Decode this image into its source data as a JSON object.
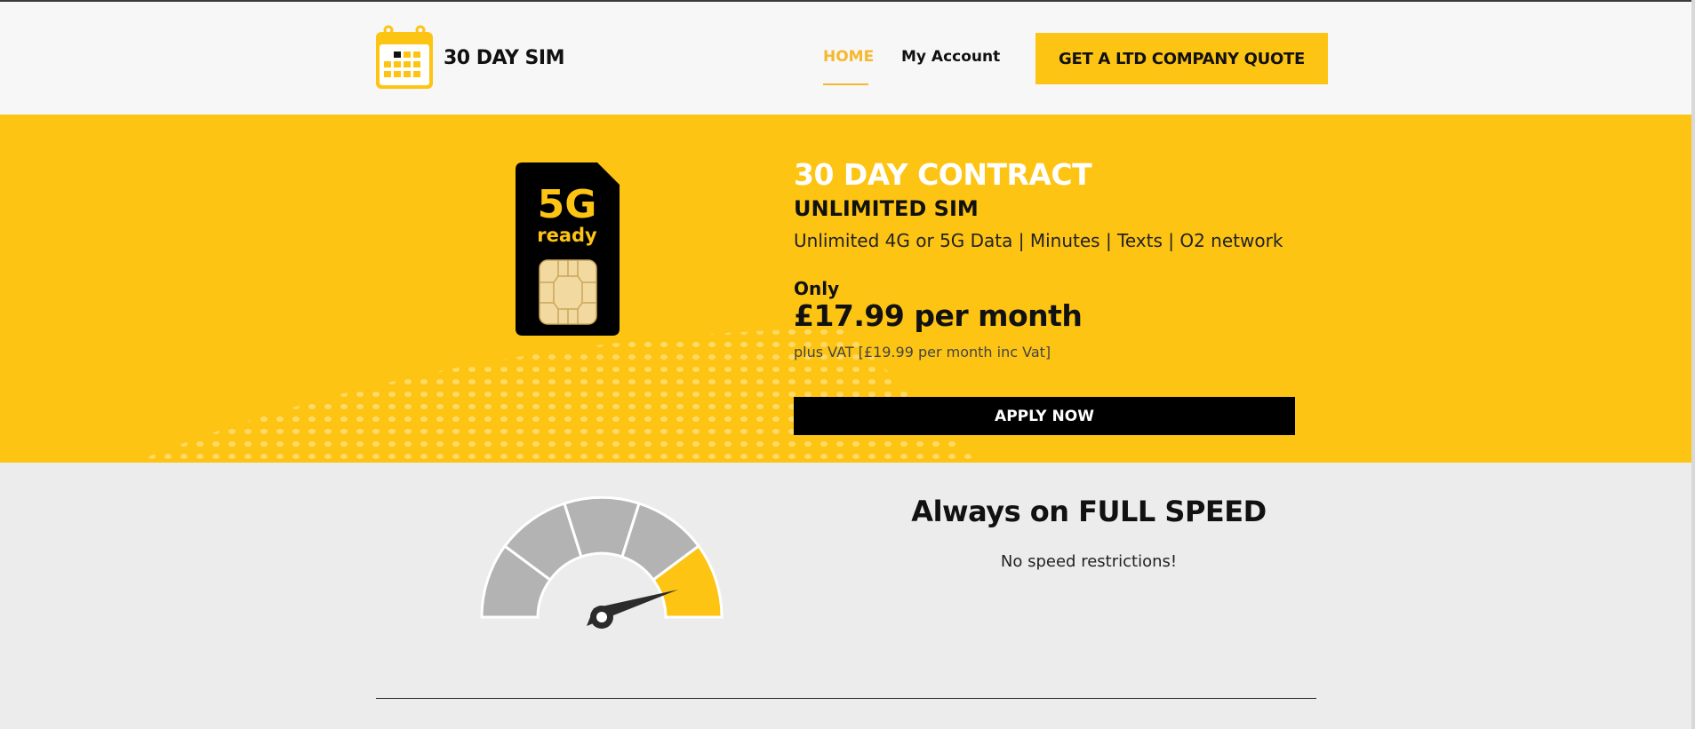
{
  "brand": {
    "name": "30 DAY SIM",
    "accent": "#fdc414",
    "logo_icon": "calendar-icon"
  },
  "nav": {
    "home": "HOME",
    "account": "My Account",
    "quote_button": "GET A LTD COMPANY QUOTE"
  },
  "hero": {
    "sim_badge_top": "5G",
    "sim_badge_bottom": "ready",
    "title": "30 DAY CONTRACT",
    "subtitle": "UNLIMITED SIM",
    "features": "Unlimited 4G or 5G Data | Minutes | Texts | O2 network",
    "only_label": "Only",
    "price": "£17.99 per month",
    "vat_note": "plus VAT [£19.99 per month inc Vat]",
    "apply_button": "APPLY NOW"
  },
  "speed": {
    "title": "Always on FULL SPEED",
    "text": "No speed restrictions!",
    "gauge_icon": "speedometer-icon"
  }
}
